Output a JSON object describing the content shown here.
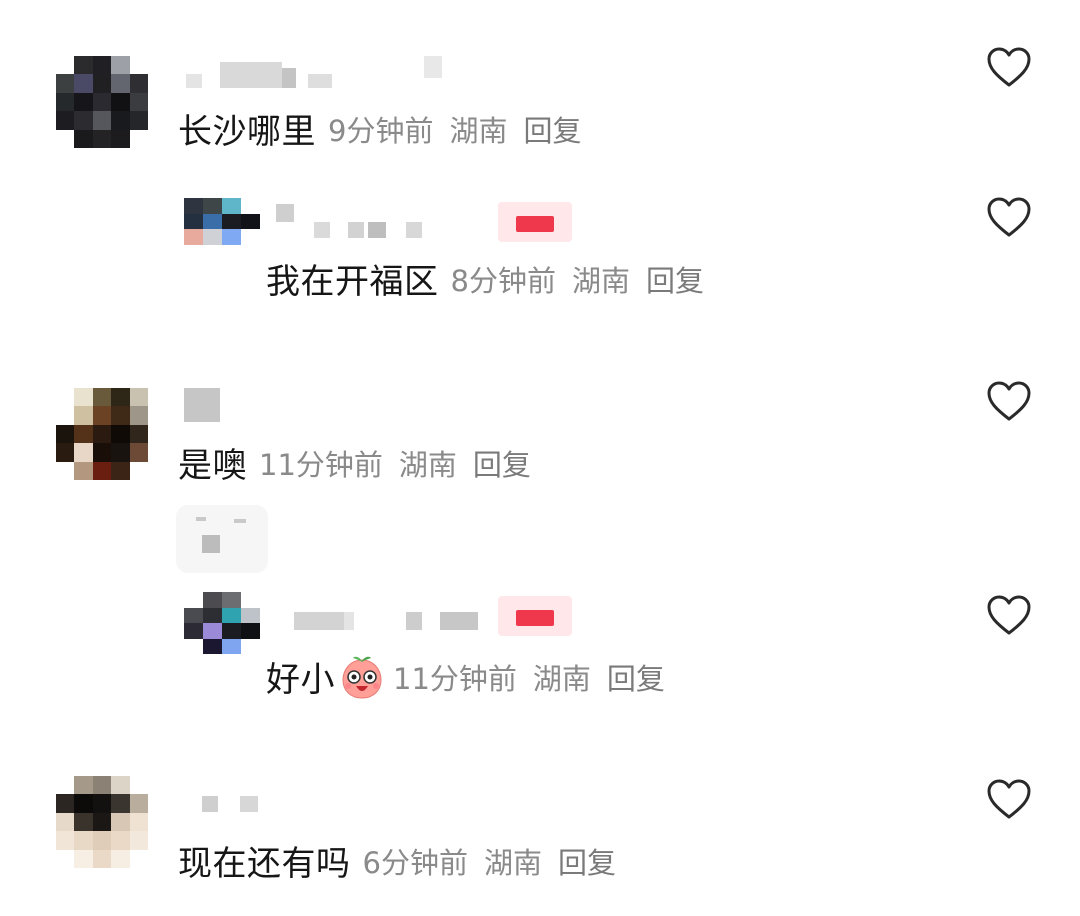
{
  "comments": [
    {
      "text": "长沙哪里",
      "time": "9分钟前",
      "location": "湖南",
      "reply_label": "回复"
    },
    {
      "text": "我在开福区",
      "time": "8分钟前",
      "location": "湖南",
      "reply_label": "回复"
    },
    {
      "text": "是噢",
      "time": "11分钟前",
      "location": "湖南",
      "reply_label": "回复"
    },
    {
      "text": "好小",
      "emoji": "peach-face-emoji",
      "time": "11分钟前",
      "location": "湖南",
      "reply_label": "回复"
    },
    {
      "text": "现在还有吗",
      "time": "6分钟前",
      "location": "湖南",
      "reply_label": "回复"
    }
  ],
  "icons": {
    "like": "heart-outline-icon"
  },
  "colors": {
    "text": "#161616",
    "meta": "#8a8a8a",
    "badge_red": "#f0384c"
  }
}
